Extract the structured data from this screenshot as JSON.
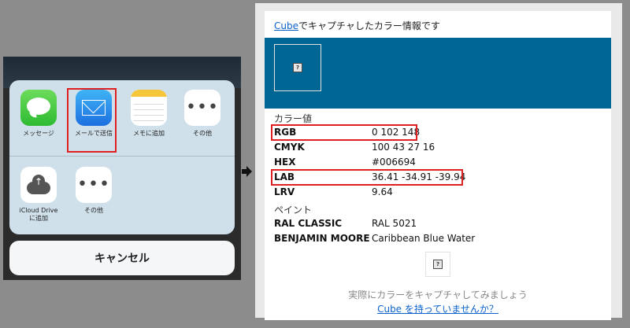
{
  "share_sheet": {
    "apps_row1": [
      {
        "label": "メッセージ",
        "icon": "messages-icon"
      },
      {
        "label": "メールで送信",
        "icon": "mail-icon"
      },
      {
        "label": "メモに追加",
        "icon": "notes-icon"
      },
      {
        "label": "その他",
        "icon": "more-icon"
      }
    ],
    "apps_row2": [
      {
        "label_line1": "iCloud Drive",
        "label_line2": "に追加",
        "icon": "icloud-drive-icon"
      },
      {
        "label": "その他",
        "icon": "more-icon"
      }
    ],
    "cancel_label": "キャンセル"
  },
  "panel": {
    "header_link": "Cube",
    "header_text": "でキャプチャしたカラー情報です",
    "swatch_color": "#006694",
    "color_values_title": "カラー値",
    "values": [
      {
        "key": "RGB",
        "value": "0 102 148"
      },
      {
        "key": "CMYK",
        "value": "100 43 27 16"
      },
      {
        "key": "HEX",
        "value": "#006694"
      },
      {
        "key": "LAB",
        "value": "36.41 -34.91 -39.94"
      },
      {
        "key": "LRV",
        "value": "9.64"
      }
    ],
    "paint_title": "ペイント",
    "paints": [
      {
        "key": "RAL CLASSIC",
        "value": "RAL 5021"
      },
      {
        "key": "BENJAMIN MOORE",
        "value": "Caribbean Blue Water"
      }
    ],
    "footer_text": "実際にカラーをキャプチャしてみましょう",
    "footer_link": "Cube を持っていませんか？"
  },
  "colors": {
    "highlight": "#e02020",
    "link": "#0c62cc",
    "swatch": "#006694"
  }
}
